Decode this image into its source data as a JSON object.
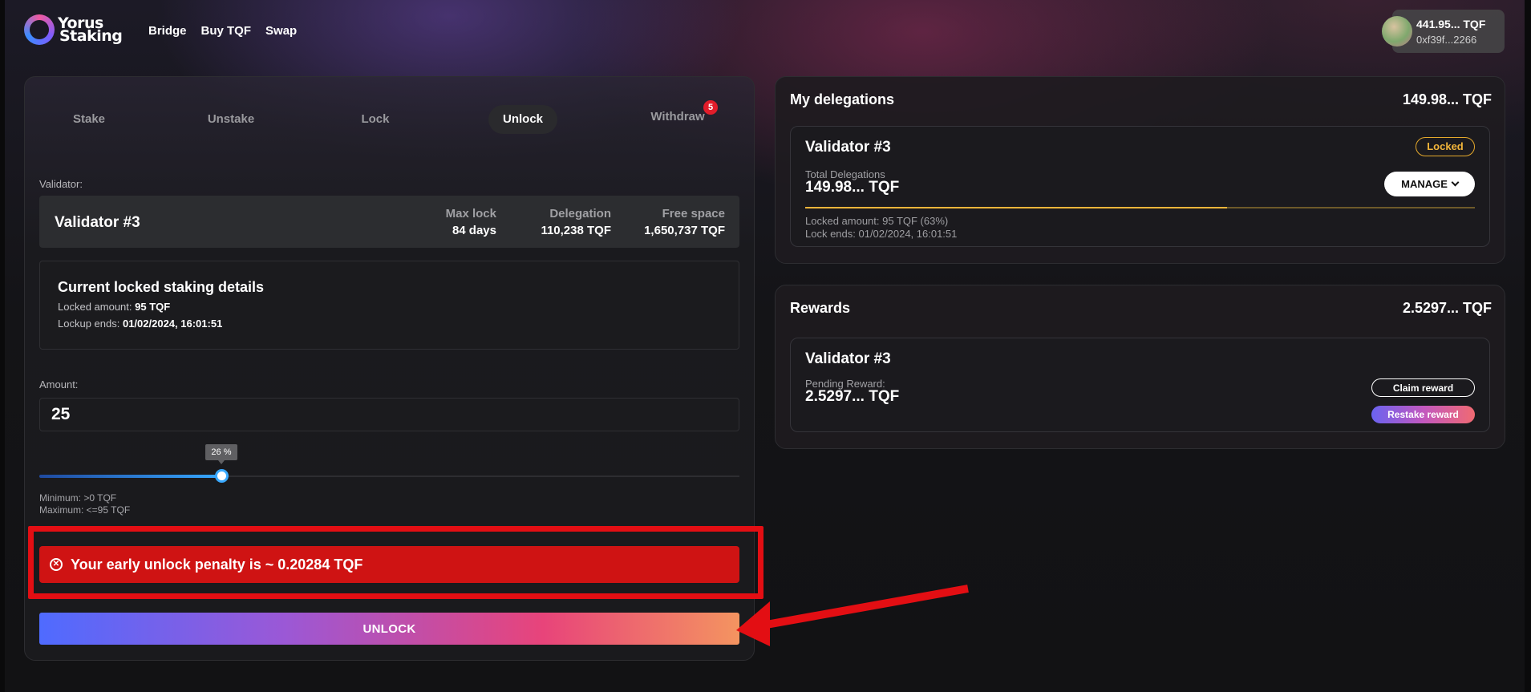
{
  "brand": {
    "line1": "Yorus",
    "line2": "Staking"
  },
  "nav": {
    "bridge": "Bridge",
    "buy": "Buy TQF",
    "swap": "Swap"
  },
  "wallet": {
    "balance": "441.95... TQF",
    "address": "0xf39f...2266"
  },
  "tabs": {
    "stake": "Stake",
    "unstake": "Unstake",
    "lock": "Lock",
    "unlock": "Unlock",
    "withdraw": "Withdraw",
    "withdraw_badge": "5",
    "active": "Unlock"
  },
  "validator": {
    "label": "Validator:",
    "name": "Validator #3",
    "max_lock_label": "Max lock",
    "max_lock": "84 days",
    "delegation_label": "Delegation",
    "delegation": "110,238 TQF",
    "free_space_label": "Free space",
    "free_space": "1,650,737 TQF"
  },
  "details": {
    "title": "Current locked staking details",
    "locked_label": "Locked amount:",
    "locked_value": "95 TQF",
    "lockup_label": "Lockup ends:",
    "lockup_value": "01/02/2024, 16:01:51"
  },
  "amount": {
    "label": "Amount:",
    "value": "25",
    "slider_percent": 26,
    "slider_tip": "26 %",
    "minimum": "Minimum: >0 TQF",
    "maximum": "Maximum: <=95 TQF"
  },
  "alert": {
    "icon": "error-circle-icon",
    "text": "Your early unlock penalty is ~ 0.20284 TQF"
  },
  "unlock_button": "UNLOCK",
  "delegations": {
    "title": "My delegations",
    "total": "149.98... TQF",
    "card": {
      "name": "Validator #3",
      "status": "Locked",
      "total_label": "Total Delegations",
      "total_value": "149.98... TQF",
      "manage": "MANAGE",
      "locked_fraction": 0.63,
      "locked_text": "Locked amount: 95 TQF (63%)",
      "lock_ends_text": "Lock ends: 01/02/2024, 16:01:51"
    }
  },
  "rewards": {
    "title": "Rewards",
    "total": "2.5297... TQF",
    "card": {
      "name": "Validator #3",
      "pending_label": "Pending Reward:",
      "pending_value": "2.5297... TQF",
      "claim": "Claim reward",
      "restake": "Restake reward"
    }
  },
  "colors": {
    "alert_red": "#cf1313",
    "annotation_red": "#e30e13",
    "locked_amber": "#f2b53a",
    "slider_blue": "#36a8ff"
  }
}
